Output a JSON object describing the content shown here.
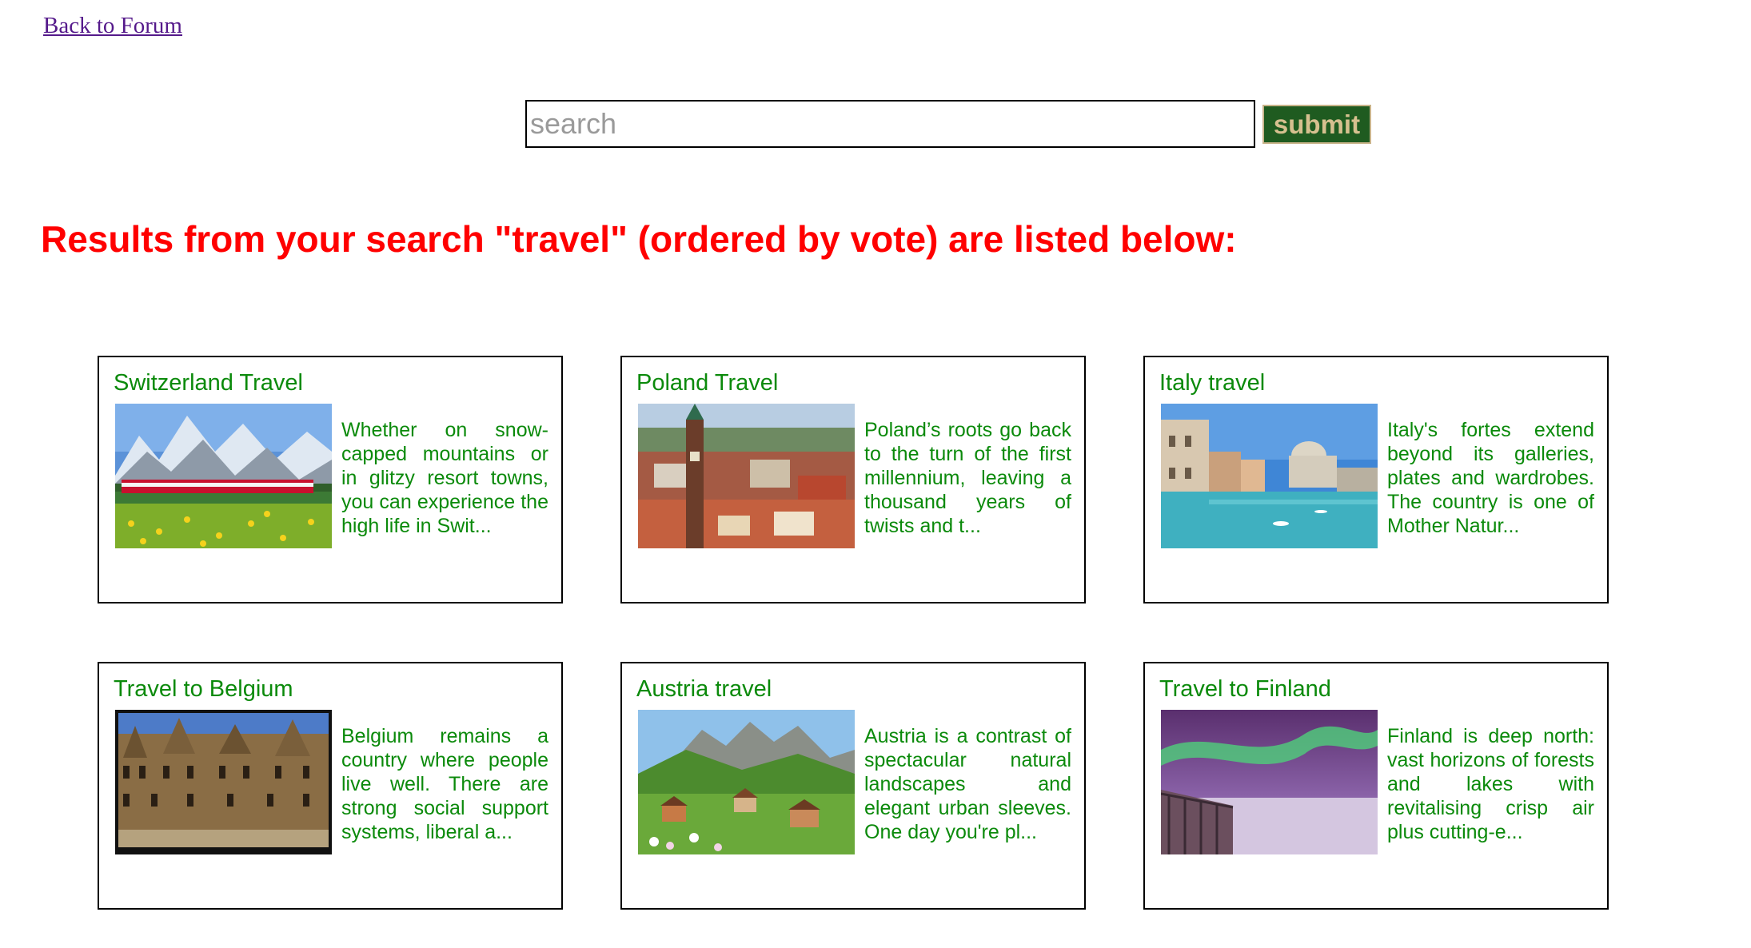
{
  "nav": {
    "back_label": "Back to Forum"
  },
  "search": {
    "placeholder": "search",
    "value": "",
    "submit_label": "submit"
  },
  "results": {
    "heading": "Results from your search \"travel\" (ordered by vote) are listed below:"
  },
  "colors": {
    "heading": "#ff0000",
    "card_text": "#0b8a0b",
    "link": "#551a8b",
    "submit_bg": "#1f5b20",
    "submit_text": "#d6c08f"
  },
  "cards": [
    {
      "title": "Switzerland Travel",
      "excerpt": "Whether on snow-capped mountains or in glitzy resort towns, you can experience the high life in Swit..."
    },
    {
      "title": "Poland Travel",
      "excerpt": "Poland’s roots go back to the turn of the first millennium, leaving a thousand years of twists and t..."
    },
    {
      "title": "Italy travel",
      "excerpt": "Italy's fortes extend beyond its galleries, plates and wardrobes. The country is one of Mother Natur..."
    },
    {
      "title": "Travel to Belgium",
      "excerpt": "Belgium remains a country where people live well. There are strong social support systems, liberal a..."
    },
    {
      "title": "Austria travel",
      "excerpt": "Austria is a contrast of spectacular natural landscapes and elegant urban sleeves. One day you're pl..."
    },
    {
      "title": "Travel to Finland",
      "excerpt": "Finland is deep north: vast horizons of forests and lakes with revitalising crisp air plus cutting-e..."
    }
  ]
}
